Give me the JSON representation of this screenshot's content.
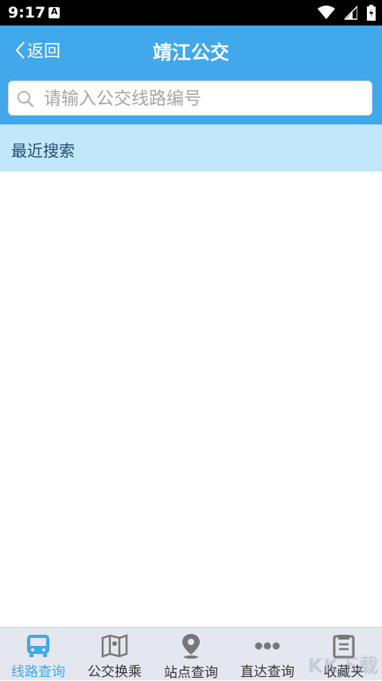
{
  "status_bar": {
    "time": "9:17",
    "notification_letter": "A"
  },
  "header": {
    "back_label": "返回",
    "title": "靖江公交",
    "background_color": "#41a8ec"
  },
  "search": {
    "placeholder": "请输入公交线路编号",
    "value": ""
  },
  "recent": {
    "label": "最近搜索"
  },
  "bottom_nav": {
    "items": [
      {
        "label": "线路查询",
        "icon": "bus-icon",
        "active": true
      },
      {
        "label": "公交换乘",
        "icon": "map-icon",
        "active": false
      },
      {
        "label": "站点查询",
        "icon": "location-pin-icon",
        "active": false
      },
      {
        "label": "直达查询",
        "icon": "dots-icon",
        "active": false
      },
      {
        "label": "收藏夹",
        "icon": "favorites-icon",
        "active": false
      }
    ],
    "active_color": "#41a8ec"
  },
  "watermark": "KK下载"
}
